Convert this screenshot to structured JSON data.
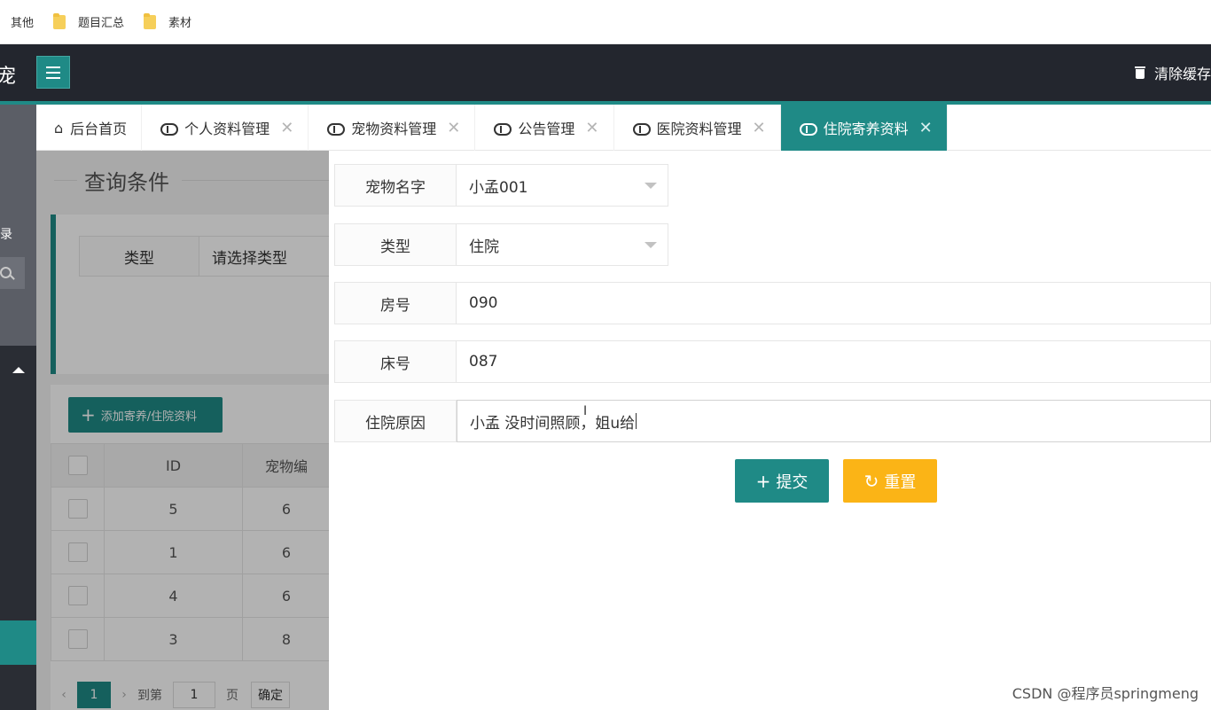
{
  "bookmarks": [
    {
      "label": "其他"
    },
    {
      "label": "题目汇总"
    },
    {
      "label": "素材"
    }
  ],
  "header": {
    "logo_fragment": "宠",
    "clear_cache": "清除缓存"
  },
  "sidebar": {
    "partial_text": "录"
  },
  "tabs": [
    {
      "label": "后台首页",
      "icon": "home-icon"
    },
    {
      "label": "个人资料管理",
      "icon": "cloud-upload-icon"
    },
    {
      "label": "宠物资料管理",
      "icon": "cloud-upload-icon"
    },
    {
      "label": "公告管理",
      "icon": "cloud-upload-icon"
    },
    {
      "label": "医院资料管理",
      "icon": "cloud-upload-icon"
    },
    {
      "label": "住院寄养资料",
      "icon": "cloud-upload-icon",
      "active": true
    }
  ],
  "background": {
    "query_title": "查询条件",
    "type_label": "类型",
    "type_placeholder": "请选择类型",
    "add_button": "添加寄养/住院资料",
    "table": {
      "headers": [
        "",
        "ID",
        "宠物编"
      ],
      "rows": [
        {
          "id": "5",
          "pet": "6"
        },
        {
          "id": "1",
          "pet": "6"
        },
        {
          "id": "4",
          "pet": "6"
        },
        {
          "id": "3",
          "pet": "8"
        }
      ]
    },
    "pager": {
      "current": "1",
      "goto_label": "到第",
      "page_input": "1",
      "page_label": "页",
      "confirm": "确定"
    }
  },
  "form": {
    "pet_name": {
      "label": "宠物名字",
      "value": "小孟001"
    },
    "type": {
      "label": "类型",
      "value": "住院"
    },
    "room": {
      "label": "房号",
      "value": "090"
    },
    "bed": {
      "label": "床号",
      "value": "087"
    },
    "reason": {
      "label": "住院原因",
      "value": "小孟 没时间照顾，姐u给"
    },
    "submit": "提交",
    "reset": "重置"
  },
  "watermark": "CSDN @程序员springmeng",
  "colors": {
    "primary": "#1f8a86",
    "warning": "#fbb416",
    "header_bg": "#23262e"
  }
}
